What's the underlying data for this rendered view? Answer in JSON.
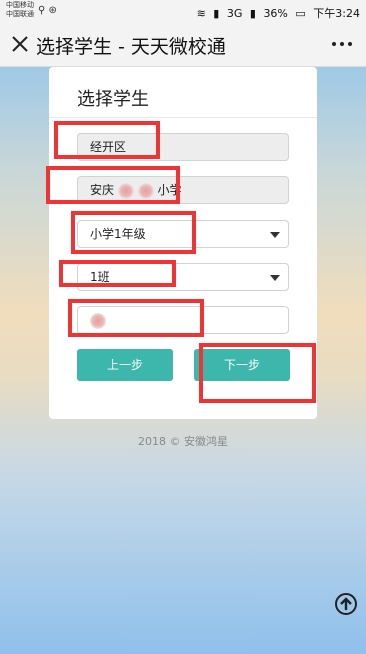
{
  "status_bar": {
    "carrier_line1": "中国移动",
    "carrier_line2": "中国联通",
    "signal_text": "3G",
    "battery": "36%",
    "time": "下午3:24"
  },
  "titlebar": {
    "title": "选择学生 - 天天微校通"
  },
  "card": {
    "title": "选择学生",
    "fields": {
      "district": "经开区",
      "school_prefix": "安庆",
      "school_suffix": "小学",
      "grade": "小学1年级",
      "class": "1班"
    },
    "student_placeholder": "",
    "prev_label": "上一步",
    "next_label": "下一步"
  },
  "footer": {
    "text": "2018 © 安徽鸿星"
  },
  "colors": {
    "accent": "#3db6ab",
    "highlight_box": "#ee3434"
  }
}
